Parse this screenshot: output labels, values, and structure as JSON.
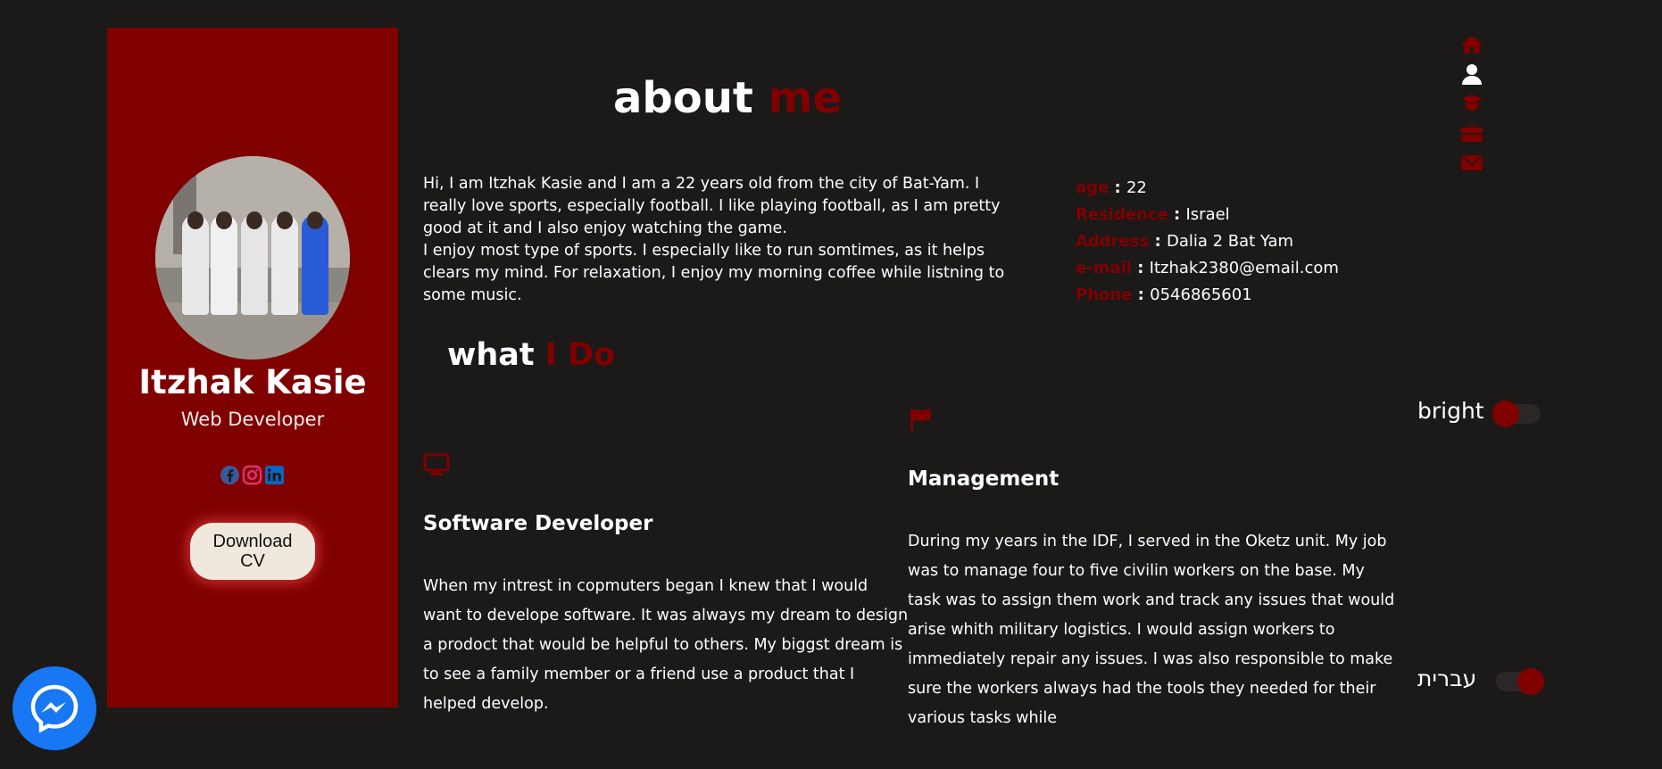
{
  "profile": {
    "name": "Itzhak Kasie",
    "role": "Web Developer",
    "cv_button": "Download CV"
  },
  "socials": [
    {
      "icon": "facebook-icon",
      "color": "#3b5998"
    },
    {
      "icon": "instagram-icon",
      "color": "#e1306c"
    },
    {
      "icon": "linkedin-icon",
      "color": "#0a66c2"
    }
  ],
  "about": {
    "heading_white": "about",
    "heading_red": "me",
    "paragraph1": "Hi, I am Itzhak Kasie and I am a 22 years old from the city of Bat-Yam. I really love sports, especially football. I like playing football, as I am pretty good at it and I also enjoy watching the game.",
    "paragraph2": "I enjoy most type of sports. I especially like to run somtimes, as it helps clears my mind. For relaxation, I enjoy my morning coffee while listning to some music."
  },
  "info": [
    {
      "label": "age",
      "value": "22"
    },
    {
      "label": "Residence",
      "value": "Israel"
    },
    {
      "label": "Address",
      "value": "Dalia 2 Bat Yam"
    },
    {
      "label": "e-mail",
      "value": "Itzhak2380@email.com"
    },
    {
      "label": "Phone",
      "value": "0546865601"
    }
  ],
  "nav": [
    {
      "icon": "home-icon",
      "active": false
    },
    {
      "icon": "user-icon",
      "active": true
    },
    {
      "icon": "graduation-cap-icon",
      "active": false
    },
    {
      "icon": "briefcase-icon",
      "active": false
    },
    {
      "icon": "envelope-icon",
      "active": false
    }
  ],
  "what_i_do": {
    "heading_white": "what",
    "heading_red": "I Do",
    "services": [
      {
        "icon": "monitor-icon",
        "title": "Software Developer",
        "text": "When my intrest in copmuters began I knew that I would want to develope software. It was always my dream to design a prodoct that would be helpful to others. My biggst dream is to see a family member or a friend use a product that I helped develop."
      },
      {
        "icon": "flag-icon",
        "title": "Management",
        "text": "During my years in the IDF, I served in the Oketz unit. My job was to manage four to five civilin workers on the base. My task was to assign them work and track any issues that would arise whith military logistics. I would assign workers to immediately repair any issues. I was also responsible to make sure the workers always had the tools they needed for their various tasks while"
      }
    ]
  },
  "toggles": {
    "theme_label": "bright",
    "theme_on": false,
    "language_label": "עברית",
    "language_on": true
  },
  "colors": {
    "accent": "#800000",
    "background": "#1c1919",
    "messenger": "#1877f2"
  }
}
